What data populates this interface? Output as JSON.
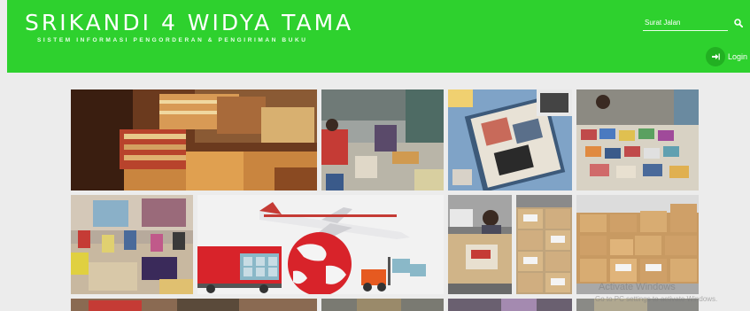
{
  "header": {
    "title": "SRIKANDI 4 WIDYA TAMA",
    "subtitle": "SISTEM INFORMASI PENGORDERAN & PENGIRIMAN BUKU",
    "background_color": "#2ed12e"
  },
  "search": {
    "placeholder": "Surat Jalan",
    "icon": "search-icon"
  },
  "login": {
    "label": "Login",
    "icon": "sign-in-icon"
  },
  "gallery": {
    "images": [
      "book-stacks-photo",
      "book-sorting-room-photo",
      "scrapbook-photo",
      "book-fair-photo",
      "classroom-photo",
      "cargo-plane-truck-illustration",
      "delivery-truck-photo",
      "boxes-stack-photo",
      "warehouse-boxes-photo"
    ]
  },
  "watermark": {
    "title": "Activate Windows",
    "subtitle": "Go to PC settings to activate Windows."
  }
}
